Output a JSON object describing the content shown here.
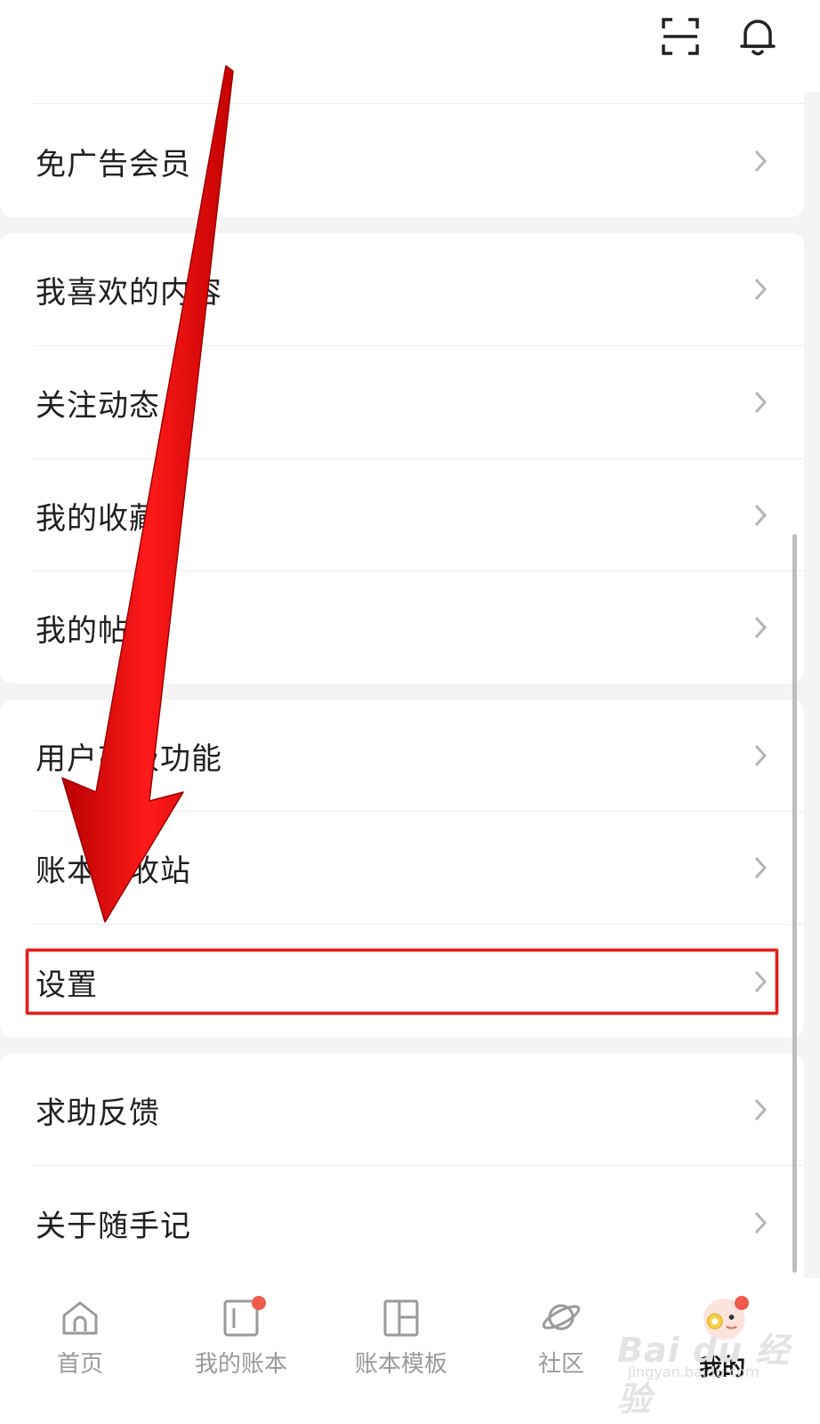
{
  "menu": {
    "group1": [
      {
        "label": "免广告会员"
      }
    ],
    "group2": [
      {
        "label": "我喜欢的内容"
      },
      {
        "label": "关注动态"
      },
      {
        "label": "我的收藏"
      },
      {
        "label": "我的帖子"
      }
    ],
    "group3": [
      {
        "label": "用户高级功能"
      },
      {
        "label": "账本回收站"
      },
      {
        "label": "设置"
      }
    ],
    "group4": [
      {
        "label": "求助反馈"
      },
      {
        "label": "关于随手记"
      }
    ]
  },
  "bottom_nav": [
    {
      "label": "首页",
      "icon": "home-icon"
    },
    {
      "label": "我的账本",
      "icon": "ledger-icon",
      "badge": true
    },
    {
      "label": "账本模板",
      "icon": "template-icon"
    },
    {
      "label": "社区",
      "icon": "planet-icon"
    },
    {
      "label": "我的",
      "icon": "avatar-icon",
      "badge": true,
      "active": true
    }
  ],
  "top_icons": [
    "scan-icon",
    "bell-icon"
  ],
  "colors": {
    "accent_red": "#e0201a",
    "badge": "#ef5a4c",
    "text": "#1f1f1f",
    "nav_inactive": "#9a9a9a"
  },
  "watermark": {
    "text": "Bai du 经验",
    "sub": "jingyan.baidu.com"
  }
}
